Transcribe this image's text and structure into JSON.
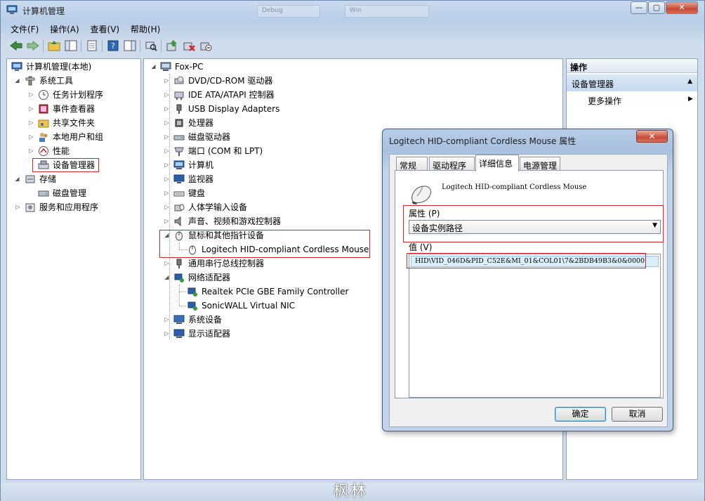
{
  "window": {
    "title": "计算机管理",
    "ghost_tabs": [
      "Debug",
      "Win"
    ],
    "caption": {
      "minimize": "—",
      "maximize": "▢",
      "close": "✕"
    }
  },
  "menu": [
    "文件(F)",
    "操作(A)",
    "查看(V)",
    "帮助(H)"
  ],
  "left_tree": [
    {
      "label": "计算机管理(本地)",
      "icon": "computer-mgmt-icon"
    },
    {
      "label": "系统工具",
      "icon": "tools-icon"
    },
    {
      "label": "任务计划程序",
      "icon": "clock-icon"
    },
    {
      "label": "事件查看器",
      "icon": "event-viewer-icon"
    },
    {
      "label": "共享文件夹",
      "icon": "shared-folder-icon"
    },
    {
      "label": "本地用户和组",
      "icon": "users-icon"
    },
    {
      "label": "性能",
      "icon": "performance-icon"
    },
    {
      "label": "设备管理器",
      "icon": "device-manager-icon"
    },
    {
      "label": "存储",
      "icon": "storage-icon"
    },
    {
      "label": "磁盘管理",
      "icon": "disk-icon"
    },
    {
      "label": "服务和应用程序",
      "icon": "services-icon"
    }
  ],
  "device_tree": {
    "root": "Fox-PC",
    "items": [
      {
        "label": "DVD/CD-ROM 驱动器",
        "icon": "dvd-icon"
      },
      {
        "label": "IDE ATA/ATAPI 控制器",
        "icon": "ide-icon"
      },
      {
        "label": "USB Display Adapters",
        "icon": "usb-icon"
      },
      {
        "label": "处理器",
        "icon": "cpu-icon"
      },
      {
        "label": "磁盘驱动器",
        "icon": "disk-drive-icon"
      },
      {
        "label": "端口 (COM 和 LPT)",
        "icon": "port-icon"
      },
      {
        "label": "计算机",
        "icon": "computer-icon"
      },
      {
        "label": "监视器",
        "icon": "monitor-icon"
      },
      {
        "label": "键盘",
        "icon": "keyboard-icon"
      },
      {
        "label": "人体学输入设备",
        "icon": "hid-icon"
      },
      {
        "label": "声音、视频和游戏控制器",
        "icon": "sound-icon"
      },
      {
        "label": "鼠标和其他指针设备",
        "icon": "mouse-icon"
      },
      {
        "label": "Logitech HID-compliant Cordless Mouse",
        "icon": "mouse-icon"
      },
      {
        "label": "通用串行总线控制器",
        "icon": "usb-controller-icon"
      },
      {
        "label": "网络适配器",
        "icon": "network-icon"
      },
      {
        "label": "Realtek PCIe GBE Family Controller",
        "icon": "network-adapter-icon"
      },
      {
        "label": "SonicWALL Virtual NIC",
        "icon": "network-adapter-icon"
      },
      {
        "label": "系统设备",
        "icon": "system-device-icon"
      },
      {
        "label": "显示适配器",
        "icon": "display-adapter-icon"
      }
    ]
  },
  "actions": {
    "header": "操作",
    "section": "设备管理器",
    "more": "更多操作"
  },
  "dialog": {
    "title": "Logitech HID-compliant Cordless Mouse 属性",
    "tabs": [
      "常规",
      "驱动程序",
      "详细信息",
      "电源管理"
    ],
    "active_tab": "详细信息",
    "device_name": "Logitech HID-compliant Cordless Mouse",
    "property_label": "属性",
    "property_hotkey": "(P)",
    "property_value": "设备实例路径",
    "value_label": "值",
    "value_hotkey": "(V)",
    "value_text": "HID\\VID_046D&PID_C52E&MI_01&COL01\\7&2BDB49B3&0&0000",
    "ok": "确定",
    "cancel": "取消"
  },
  "watermark": "枫林",
  "colors": {
    "highlight_box": "#d0262e",
    "selection": "#ddeefb"
  }
}
